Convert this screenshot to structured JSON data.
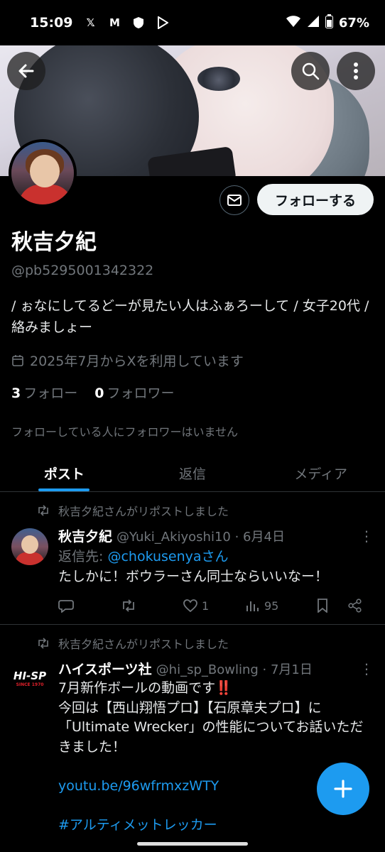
{
  "status_bar": {
    "time": "15:09",
    "battery": "67%"
  },
  "profile": {
    "name": "秋吉夕紀",
    "handle": "@pb5295001342322",
    "bio": "/ ぉなにしてるどーが見たい人はふぁろーして / 女子20代 / 絡みましょー",
    "joined": "2025年7月からXを利用しています",
    "following_count": "3",
    "following_label": "フォロー",
    "followers_count": "0",
    "followers_label": "フォロワー",
    "mutual_note": "フォローしている人にフォロワーはいません",
    "follow_button": "フォローする"
  },
  "tabs": [
    {
      "label": "ポスト",
      "active": true
    },
    {
      "label": "返信",
      "active": false
    },
    {
      "label": "メディア",
      "active": false
    }
  ],
  "posts": [
    {
      "repost_note": "秋吉夕紀さんがリポストしました",
      "author": "秋吉夕紀",
      "meta": "@Yuki_Akiyoshi10 · 6月4日",
      "reply_prefix": "返信先: ",
      "reply_to": "@chokusenyaさん",
      "text": "たしかに！ボウラーさん同士ならいいなー！",
      "likes": "1",
      "views": "95"
    },
    {
      "repost_note": "秋吉夕紀さんがリポストしました",
      "author": "ハイスポーツ社",
      "meta": "@hi_sp_Bowling · 7月1日",
      "avatar_logo": "HI-SP",
      "avatar_since": "SINCE 1970",
      "line1": "7月新作ボールの動画です‼️",
      "line2": "今回は【西山翔悟プロ】【石原章夫プロ】に「Ultimate Wrecker」の性能についてお話いただきました！",
      "link": "youtu.be/96wfrmxzWTY",
      "hashtag": "#アルティメットレッカー"
    }
  ],
  "colors": {
    "accent": "#1d9bf0",
    "background": "#000000",
    "muted": "#71767b"
  }
}
